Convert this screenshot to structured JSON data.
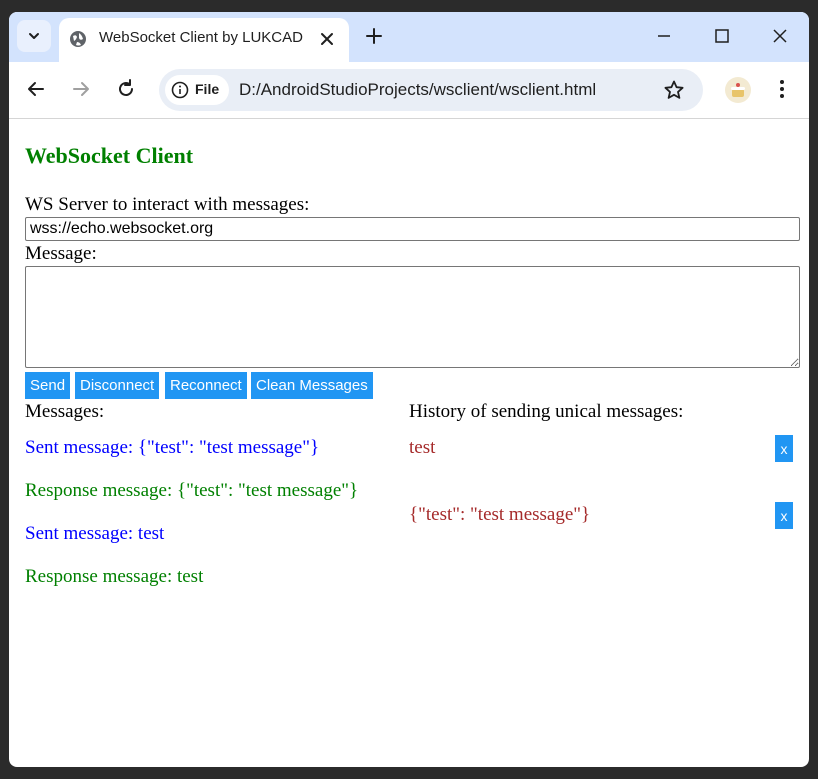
{
  "browser": {
    "tab_title": "WebSocket Client by LUKCAD",
    "omnibox_chip": "File",
    "url": "D:/AndroidStudioProjects/wsclient/wsclient.html"
  },
  "page": {
    "heading": "WebSocket Client",
    "server_label": "WS Server to interact with messages:",
    "server_value": "wss://echo.websocket.org",
    "message_label": "Message:",
    "message_value": "",
    "buttons": {
      "send": "Send",
      "disconnect": "Disconnect",
      "reconnect": "Reconnect",
      "clean": "Clean Messages"
    },
    "messages_title": "Messages:",
    "messages": [
      {
        "text": "Sent message: {\"test\": \"test message\"}",
        "kind": "sent"
      },
      {
        "text": "Response message: {\"test\": \"test message\"}",
        "kind": "response"
      },
      {
        "text": "Sent message: test",
        "kind": "sent"
      },
      {
        "text": "Response message: test",
        "kind": "response"
      }
    ],
    "history_title": "History of sending unical messages:",
    "history": [
      {
        "text": "test",
        "remove_label": "x"
      },
      {
        "text": "{\"test\": \"test message\"}",
        "remove_label": "x"
      }
    ]
  },
  "colors": {
    "accent": "#2196f3",
    "heading": "#008000",
    "sent": "#0000ff",
    "response": "#008000",
    "history": "#a52a2a",
    "tabstrip": "#d3e3fd"
  }
}
